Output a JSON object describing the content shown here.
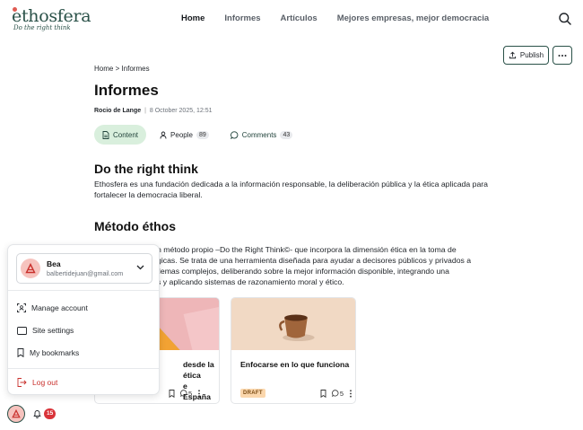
{
  "brand": {
    "name": "ethosfera",
    "tagline": "Do the right think",
    "accent": "#2a5148"
  },
  "nav": {
    "items": [
      {
        "label": "Home",
        "active": true
      },
      {
        "label": "Informes",
        "active": false
      },
      {
        "label": "Artículos",
        "active": false
      },
      {
        "label": "Mejores empresas, mejor democracia",
        "active": false
      }
    ]
  },
  "toolbar": {
    "publish_label": "Publish",
    "more_icon": "ellipsis-icon"
  },
  "breadcrumb": "Home > Informes",
  "page": {
    "title": "Informes",
    "author": "Rocio de Lange",
    "separator": "|",
    "date": "8 October 2025, 12:51"
  },
  "tabs": [
    {
      "label": "Content",
      "icon": "document-icon",
      "active": true
    },
    {
      "label": "People",
      "icon": "person-icon",
      "count": "89"
    },
    {
      "label": "Comments",
      "icon": "comment-icon",
      "count": "43"
    }
  ],
  "sections": [
    {
      "heading": "Do the right think",
      "text": "Ethosfera es una fundación dedicada a la información responsable, la deliberación pública y la ética aplicada para fortalecer la democracia liberal."
    },
    {
      "heading": "Método éthos",
      "text_lines": [
        "n método propio –Do the Right Think©- que incorpora la dimensión ética en la toma de",
        "gicas. Se trata de una herramienta diseñada para ayudar a decisores públicos y privados a",
        "ilemas complejos, deliberando sobre la mejor información disponible,  integrando una",
        "s y aplicando sistemas de razonamiento moral y ético."
      ]
    }
  ],
  "cards": [
    {
      "title_lines": [
        "desde la ética",
        "e España"
      ],
      "comments": "5"
    },
    {
      "title": "Enfocarse en lo que funciona",
      "status": "DRAFT",
      "comments": "5"
    }
  ],
  "account_menu": {
    "user_name": "Bea",
    "user_email": "balbertidejuan@gmail.com",
    "items": [
      {
        "label": "Manage account",
        "icon": "account-scan-icon"
      },
      {
        "label": "Site settings",
        "icon": "window-icon"
      },
      {
        "label": "My bookmarks",
        "icon": "bookmark-icon"
      }
    ],
    "logout_label": "Log out",
    "logout_color": "#c9302c"
  },
  "notifications": {
    "count": "15",
    "badge_color": "#d9343a"
  }
}
